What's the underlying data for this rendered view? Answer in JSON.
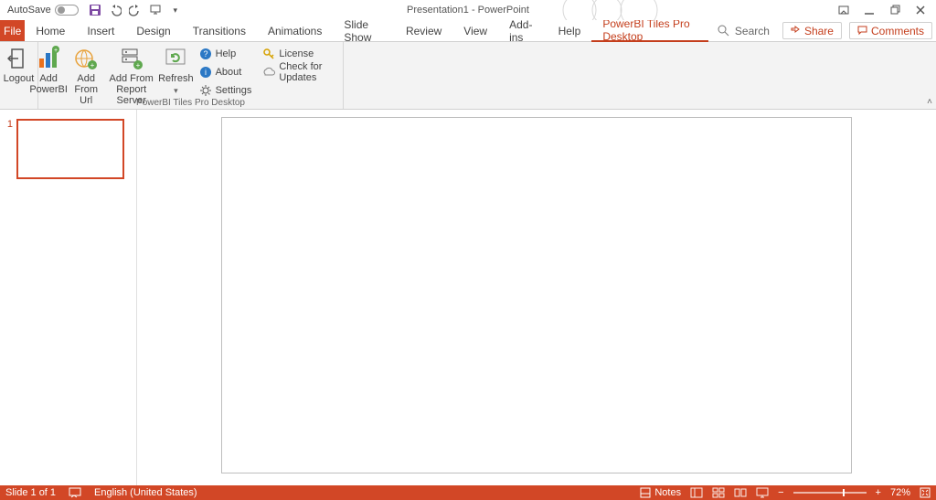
{
  "titlebar": {
    "autosave_label": "AutoSave",
    "autosave_state": "Off",
    "doc_title": "Presentation1 - PowerPoint"
  },
  "tabs": {
    "file": "File",
    "items": [
      "Home",
      "Insert",
      "Design",
      "Transitions",
      "Animations",
      "Slide Show",
      "Review",
      "View",
      "Add-ins",
      "Help",
      "PowerBI Tiles Pro Desktop"
    ],
    "active_index": 10,
    "search_placeholder": "Search",
    "share": "Share",
    "comments": "Comments"
  },
  "ribbon": {
    "group_label": "PowerBI Tiles Pro Desktop",
    "logout": "Logout",
    "add_powerbi": "Add PowerBI",
    "add_from_url": "Add From Url",
    "add_from_rs": "Add From Report Server",
    "refresh": "Refresh",
    "help": "Help",
    "about": "About",
    "settings": "Settings",
    "license": "License",
    "updates": "Check for Updates"
  },
  "thumbs": {
    "slide1_number": "1"
  },
  "status": {
    "slide_counter": "Slide 1 of 1",
    "language": "English (United States)",
    "notes": "Notes",
    "zoom_percent": "72%"
  }
}
